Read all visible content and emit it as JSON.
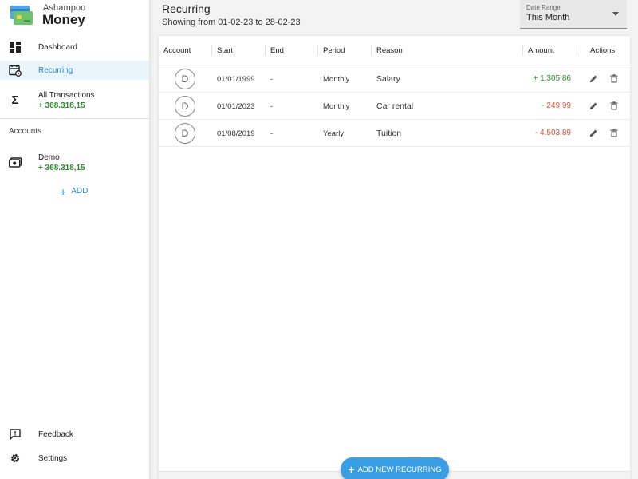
{
  "app": {
    "brand_small": "Ashampoo",
    "brand_big": "Money"
  },
  "sidebar": {
    "nav": [
      {
        "label": "Dashboard",
        "icon": "dashboard-icon"
      },
      {
        "label": "Recurring",
        "icon": "calendar-recurring-icon",
        "active": true
      }
    ],
    "all_transactions": {
      "label": "All Transactions",
      "amount": "+ 368.318,15",
      "icon": "sigma-icon"
    },
    "accounts_label": "Accounts",
    "accounts": [
      {
        "name": "Demo",
        "amount": "+ 368.318,15",
        "icon": "wallet-icon"
      }
    ],
    "add_label": "ADD",
    "bottom": [
      {
        "label": "Feedback",
        "icon": "feedback-icon"
      },
      {
        "label": "Settings",
        "icon": "gear-icon"
      }
    ]
  },
  "header": {
    "title": "Recurring",
    "subtitle": "Showing from 01-02-23 to 28-02-23"
  },
  "date_range": {
    "label": "Date Range",
    "value": "This Month"
  },
  "table": {
    "columns": [
      "Account",
      "Start",
      "End",
      "Period",
      "Reason",
      "Amount",
      "Actions"
    ],
    "rows": [
      {
        "avatar": "D",
        "start": "01/01/1999",
        "end": "-",
        "period": "Monthly",
        "reason": "Salary",
        "amount": "+ 1.305,86",
        "sign": "pos"
      },
      {
        "avatar": "D",
        "start": "01/01/2023",
        "end": "-",
        "period": "Monthly",
        "reason": "Car rental",
        "amount": "- 249,99",
        "sign": "neg"
      },
      {
        "avatar": "D",
        "start": "01/08/2019",
        "end": "-",
        "period": "Yearly",
        "reason": "Tuition",
        "amount": "- 4.503,89",
        "sign": "neg"
      }
    ]
  },
  "fab": {
    "label": "ADD NEW RECURRING"
  },
  "colors": {
    "accent": "#2f8ad4",
    "positive": "#2e8b30",
    "negative": "#e0533a",
    "fab": "#3a9ee4"
  }
}
